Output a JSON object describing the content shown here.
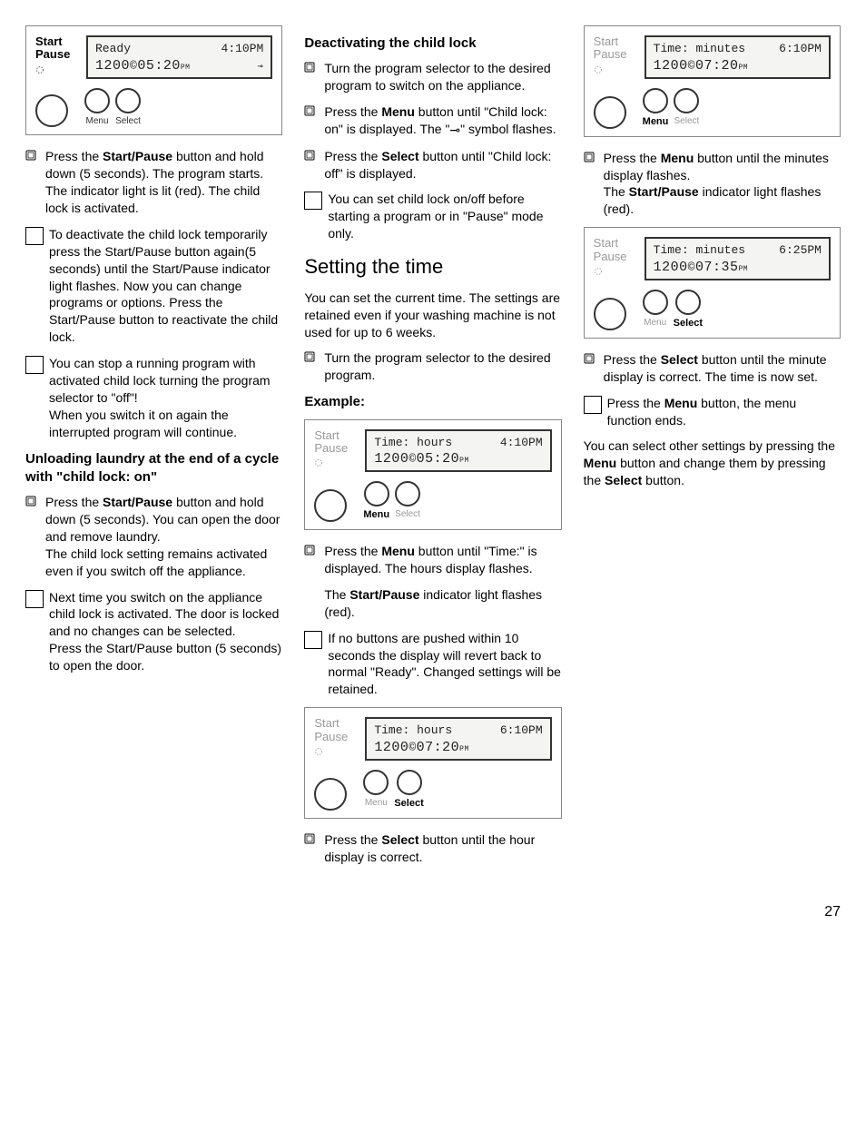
{
  "pageNumber": "27",
  "col1": {
    "panel1": {
      "startPause": "Start\nPause",
      "lcd_line1_left": "Ready",
      "lcd_line1_right": "4:10PM",
      "lcd_line2_seg": "1200",
      "lcd_line2_time": "05:20",
      "lcd_line2_pm": "PM",
      "menu": "Menu",
      "select": "Select"
    },
    "b1": "Press the <b>Start/Pause</b> button and hold down (5 seconds). The program starts. The indicator light is lit (red). The child lock is activated.",
    "n1": "To deactivate the child lock temporarily press the Start/Pause button again(5 seconds) until the Start/Pause indicator light flashes. Now you can change programs or options. Press the Start/Pause button to reactivate the child lock.",
    "n2": "You can stop a running program with activated child lock turning the program selector to \"off\"!<br>When you switch it on again the interrupted program will continue.",
    "h1": "Unloading laundry at the end of a cycle with \"child lock: on\"",
    "b2": "Press the <b>Start/Pause</b> button and hold down (5 seconds). You can open the door and remove laundry.<br>The child lock setting remains activated even if you switch off the appliance.",
    "n3": "Next time you switch on the appliance child lock is activated. The door is locked and no changes can be selected.<br>Press the Start/Pause button (5 seconds) to open the door."
  },
  "col2": {
    "h1": "Deactivating the child lock",
    "b1": "Turn the program selector to the desired program to switch on the appliance.",
    "b2": "Press the <b>Menu</b> button until \"Child lock: on\" is displayed. The \"<span class='keyicon'>⊸</span>\" symbol flashes.",
    "b3": "Press the <b>Select</b> button until \"Child lock: off\" is displayed.",
    "n1": "You can set child lock on/off before starting a program or in \"Pause\" mode only.",
    "h2": "Setting the time",
    "p1": "You can set the current time. The settings are retained even if your washing machine is not used for up to 6 weeks.",
    "b4": "Turn the program selector to the desired program.",
    "h3": "Example:",
    "panel2": {
      "startPause": "Start\nPause",
      "lcd_line1_left": "Time: hours",
      "lcd_line1_right": "4:10PM",
      "lcd_line2_seg": "1200",
      "lcd_line2_time": "05:20",
      "lcd_line2_pm": "PM",
      "menu": "Menu",
      "select": "Select"
    },
    "b5": "Press the <b>Menu</b> button until \"Time:\" is displayed. The hours display flashes.",
    "p2": "The <b>Start/Pause</b> indicator light flashes (red).",
    "n2": "If no buttons are pushed within 10 seconds the display will revert back to normal \"Ready\". Changed settings will be retained.",
    "panel3": {
      "startPause": "Start\nPause",
      "lcd_line1_left": "Time: hours",
      "lcd_line1_right": "6:10PM",
      "lcd_line2_seg": "1200",
      "lcd_line2_time": "07:20",
      "lcd_line2_pm": "PM",
      "menu": "Menu",
      "select": "Select"
    },
    "b6": "Press the <b>Select</b> button until the hour display is correct."
  },
  "col3": {
    "panel1": {
      "startPause": "Start\nPause",
      "lcd_line1_left": "Time: minutes",
      "lcd_line1_right": "6:10PM",
      "lcd_line2_seg": "1200",
      "lcd_line2_time": "07:20",
      "lcd_line2_pm": "PM",
      "menu": "Menu",
      "select": "Select"
    },
    "b1": "Press the <b>Menu</b> button until the minutes display flashes.<br>The <b>Start/Pause</b> indicator light flashes (red).",
    "panel2": {
      "startPause": "Start\nPause",
      "lcd_line1_left": "Time: minutes",
      "lcd_line1_right": "6:25PM",
      "lcd_line2_seg": "1200",
      "lcd_line2_time": "07:35",
      "lcd_line2_pm": "PM",
      "menu": "Menu",
      "select": "Select"
    },
    "b2": "Press the <b>Select</b> button until the minute display is correct. The time is now set.",
    "n1": "Press the <b>Menu</b> button, the menu function ends.",
    "p1": "You can select other settings by pressing the <b>Menu</b> button and change them by pressing the <b>Select</b> button."
  }
}
